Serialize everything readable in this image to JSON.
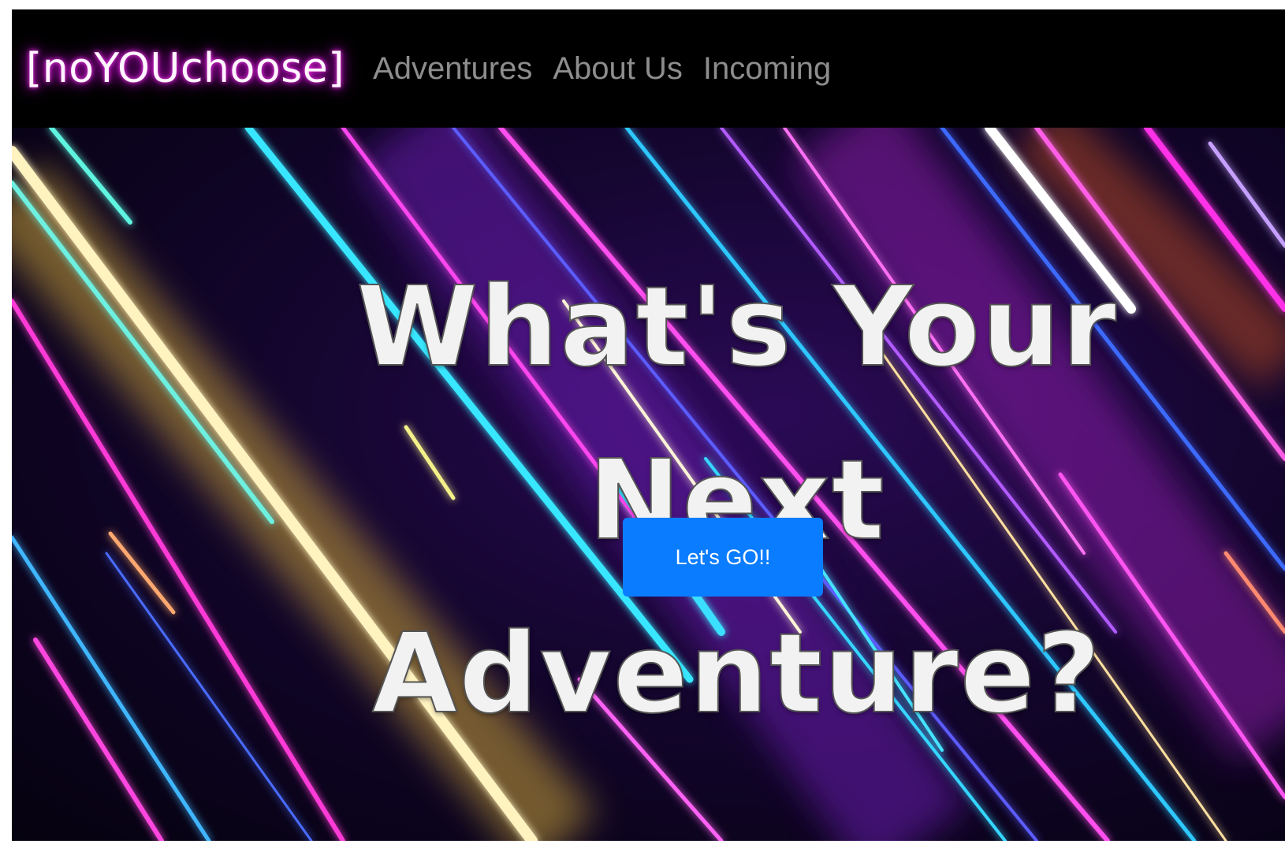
{
  "navbar": {
    "brand": "[noYOUchoose]",
    "links": [
      {
        "label": "Adventures"
      },
      {
        "label": "About Us"
      },
      {
        "label": "Incoming"
      }
    ]
  },
  "hero": {
    "title_line1": "What's Your Next",
    "title_line2": "Adventure?",
    "cta_label": "Let's GO!!"
  },
  "colors": {
    "navbar_bg": "#000000",
    "brand_glow": "#e100e6",
    "nav_link": "#8d8d8d",
    "cta_bg": "#0a7cff",
    "title_text": "#f2f2f2"
  }
}
